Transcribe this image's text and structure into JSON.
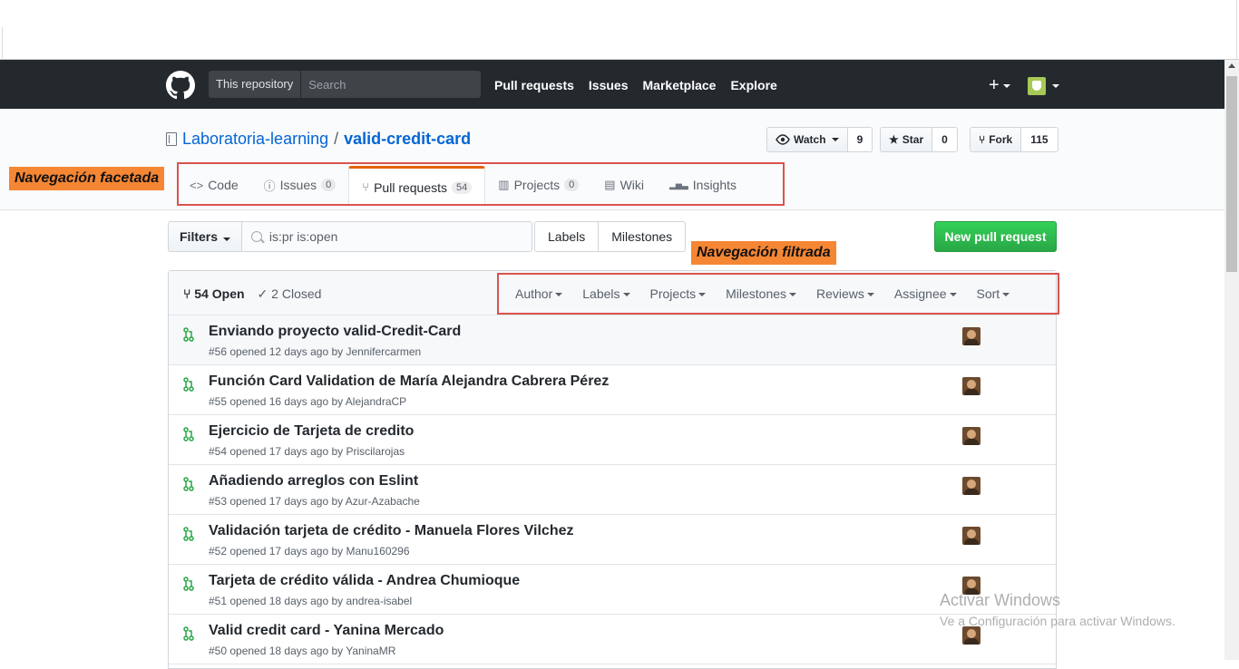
{
  "header": {
    "scope_label": "This repository",
    "search_placeholder": "Search",
    "nav": [
      "Pull requests",
      "Issues",
      "Marketplace",
      "Explore"
    ],
    "plus": "+"
  },
  "repo": {
    "owner": "Laboratoria-learning",
    "separator": "/",
    "name": "valid-credit-card",
    "watch": {
      "label": "Watch",
      "count": "9"
    },
    "star": {
      "label": "Star",
      "count": "0"
    },
    "fork": {
      "label": "Fork",
      "count": "115"
    }
  },
  "tabs": [
    {
      "label": "Code",
      "icon": "code-icon",
      "glyph": "<>"
    },
    {
      "label": "Issues",
      "icon": "issue-icon",
      "glyph": "ⓘ",
      "count": "0"
    },
    {
      "label": "Pull requests",
      "icon": "git-pull-request-icon",
      "glyph": "⑂",
      "count": "54",
      "selected": true
    },
    {
      "label": "Projects",
      "icon": "project-icon",
      "glyph": "▥",
      "count": "0"
    },
    {
      "label": "Wiki",
      "icon": "book-icon",
      "glyph": "▤"
    },
    {
      "label": "Insights",
      "icon": "graph-icon",
      "glyph": "▂▅▃"
    }
  ],
  "annotations": {
    "tabs_label": "Navegación facetada",
    "filters_label": "Navegación filtrada",
    "accent": "#f58634",
    "box_color": "#d9534f"
  },
  "filters": {
    "button": "Filters",
    "query": "is:pr is:open",
    "labels": "Labels",
    "milestones": "Milestones",
    "new_pr": "New pull request"
  },
  "list": {
    "open": "54 Open",
    "closed": "2 Closed",
    "facets": [
      "Author",
      "Labels",
      "Projects",
      "Milestones",
      "Reviews",
      "Assignee",
      "Sort"
    ],
    "items": [
      {
        "title": "Enviando proyecto valid-Credit-Card",
        "meta": "#56 opened 12 days ago by Jennifercarmen"
      },
      {
        "title": "Función Card Validation de María Alejandra Cabrera Pérez",
        "meta": "#55 opened 16 days ago by AlejandraCP"
      },
      {
        "title": "Ejercicio de Tarjeta de credito",
        "meta": "#54 opened 17 days ago by Priscilarojas"
      },
      {
        "title": "Añadiendo arreglos con Eslint",
        "meta": "#53 opened 17 days ago by Azur-Azabache"
      },
      {
        "title": "Validación tarjeta de crédito - Manuela Flores Vilchez",
        "meta": "#52 opened 17 days ago by Manu160296"
      },
      {
        "title": "Tarjeta de crédito válida - Andrea Chumioque",
        "meta": "#51 opened 18 days ago by andrea-isabel"
      },
      {
        "title": "Valid credit card - Yanina Mercado",
        "meta": "#50 opened 18 days ago by YaninaMR"
      }
    ]
  },
  "watermark": {
    "line1": "Activar Windows",
    "line2": "Ve a Configuración para activar Windows."
  },
  "colors": {
    "header_bg": "#24292e",
    "link": "#0366d6",
    "green": "#28a745",
    "tab_accent": "#e36209"
  }
}
